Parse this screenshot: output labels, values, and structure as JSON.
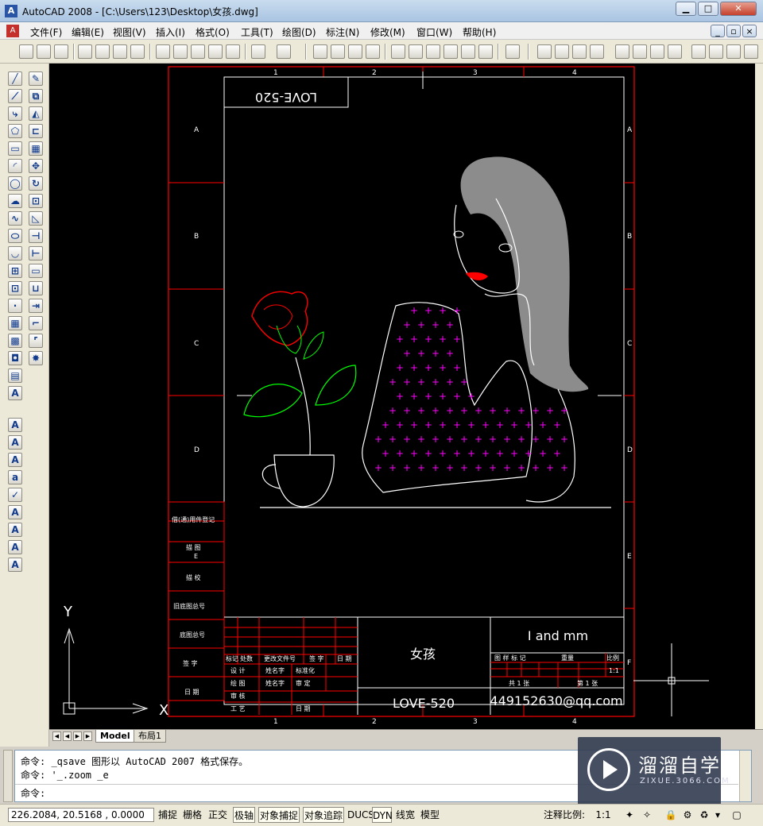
{
  "window": {
    "title": "AutoCAD 2008 - [C:\\Users\\123\\Desktop\\女孩.dwg]",
    "app_icon": "AutoCAD app icon"
  },
  "menu": [
    "文件(F)",
    "编辑(E)",
    "视图(V)",
    "插入(I)",
    "格式(O)",
    "工具(T)",
    "绘图(D)",
    "标注(N)",
    "修改(M)",
    "窗口(W)",
    "帮助(H)"
  ],
  "left_toolbar": {
    "text_button": "A"
  },
  "drawing": {
    "border_col_numbers": [
      "1",
      "2",
      "3",
      "4"
    ],
    "border_row_letters": [
      "A",
      "B",
      "C",
      "D",
      "E",
      "F"
    ],
    "top_left_box": "LOVE-520",
    "left_panel_labels": [
      "借(通)用件登记",
      "描 图",
      "描 校",
      "旧底图总号",
      "底图总号",
      "签 字",
      "日 期"
    ],
    "left_panel_small": "E",
    "title_block": {
      "drawing_name": "女孩",
      "drawing_no": "LOVE-520",
      "company_line": "I and mm",
      "email": "449152630@qq.com",
      "rev_header": [
        "标记",
        "处数",
        "更改文件号",
        "签 字",
        "日 期"
      ],
      "rows": [
        [
          "设 计",
          "姓名字",
          "标准化"
        ],
        [
          "绘 图",
          "姓名字",
          "审 定"
        ],
        [
          "审 核"
        ],
        [
          "工 艺",
          "日 期"
        ]
      ],
      "stage_header": [
        "图 样 标 记",
        "重量",
        "比例"
      ],
      "scale": "1:1",
      "sheet": [
        "共 1 张",
        "第 1 张"
      ]
    },
    "colors": {
      "border": "#ff0000",
      "lines": "#ffffff",
      "hair": "#8c8c8c",
      "hatch": "#ff00ff",
      "rose": "#ff0000",
      "leaves": "#00ff00"
    }
  },
  "layout_tabs": [
    "Model",
    "布局1"
  ],
  "command_lines": [
    "命令: _qsave 图形以 AutoCAD 2007 格式保存。",
    "命令: '_.zoom _e",
    "命令:"
  ],
  "status": {
    "coords": "226.2084, 20.5168 , 0.0000",
    "buttons": [
      "捕捉",
      "栅格",
      "正交",
      "极轴",
      "对象捕捉",
      "对象追踪",
      "DUCS",
      "DYN",
      "线宽",
      "模型"
    ],
    "anno_scale_label": "注释比例:",
    "anno_scale": "1:1"
  },
  "watermark": {
    "big": "溜溜自学",
    "small": "ZIXUE.3066.COM"
  }
}
